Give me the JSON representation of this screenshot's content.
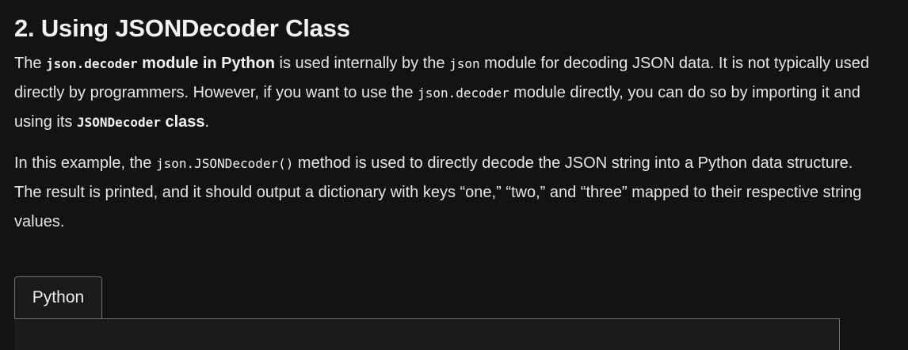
{
  "section": {
    "heading": "2. Using JSONDecoder Class"
  },
  "para1": {
    "t1": "The ",
    "c1": "json.decoder",
    "b1": " module in Python",
    "t2": " is used internally by the ",
    "c2": "json",
    "t3": " module for decoding JSON data. It is not typically used directly by programmers. However, if you want to use the ",
    "c3": "json.decoder",
    "t4": " module directly, you can do so by importing it and using its ",
    "c4": "JSONDecoder",
    "b2": " class",
    "t5": "."
  },
  "para2": {
    "t1": "In this example, the ",
    "c1": "json.JSONDecoder()",
    "t2": " method is used to directly decode the JSON string into a Python data structure. The result is printed, and it should output a dictionary with keys “one,” “two,” and “three” mapped to their respective string values."
  },
  "code_block": {
    "tab_label": "Python"
  }
}
